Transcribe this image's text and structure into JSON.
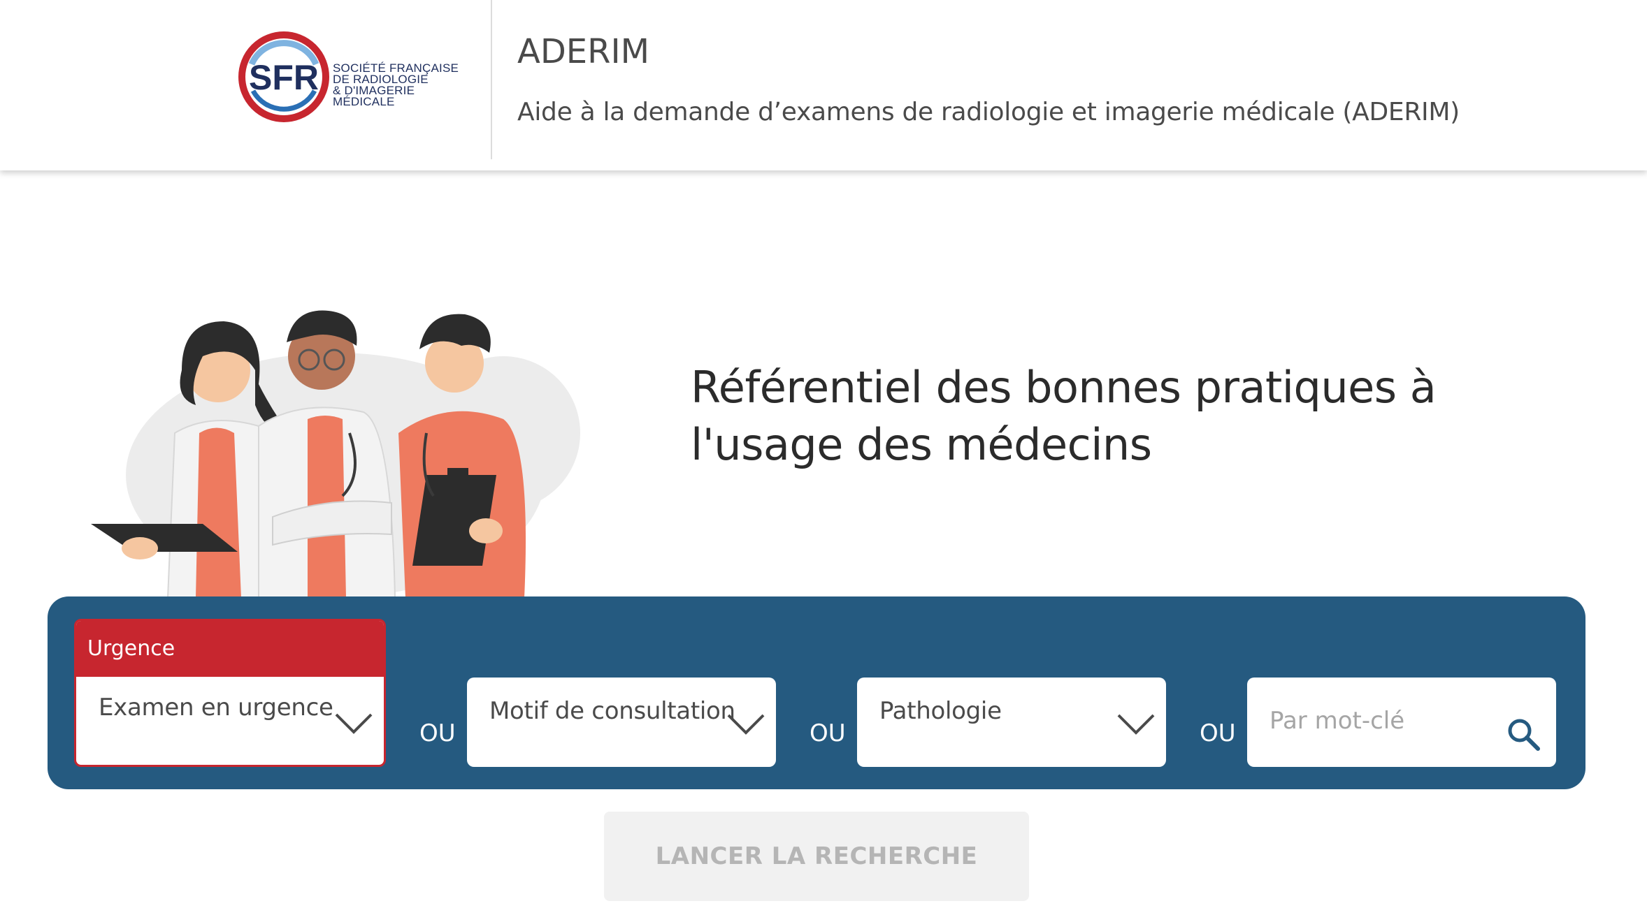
{
  "header": {
    "logo": {
      "initials": "SFR",
      "lines": [
        "SOCIÉTÉ FRANÇAISE",
        "DE RADIOLOGIE",
        "& D'IMAGERIE MÉDICALE"
      ]
    },
    "app_title": "ADERIM",
    "app_subtitle": "Aide à la demande d’examens de radiologie et imagerie médicale (ADERIM)"
  },
  "hero": {
    "title_line1": "Référentiel des bonnes pratiques à",
    "title_line2": "l'usage des médecins",
    "illustration": "three-doctors-illustration"
  },
  "search": {
    "urgence": {
      "label": "Urgence",
      "value": "Examen en urgence"
    },
    "separator": "OU",
    "motif": {
      "value": "Motif de consultation"
    },
    "pathologie": {
      "value": "Pathologie"
    },
    "keyword": {
      "placeholder": "Par mot-clé",
      "icon": "search-icon"
    },
    "launch_label": "LANCER LA RECHERCHE"
  },
  "colors": {
    "panel": "#255a80",
    "urgence": "#c7262f",
    "logo_blue": "#2a6fb5",
    "logo_red": "#c7262f"
  }
}
